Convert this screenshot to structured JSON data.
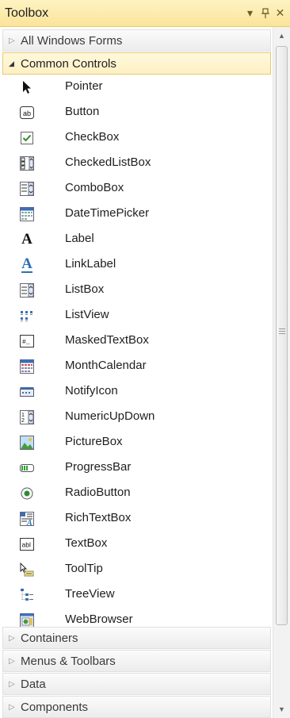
{
  "titlebar": {
    "title": "Toolbox",
    "dropdown_icon": "▾",
    "pin_icon": "⫠",
    "close_icon": "✕"
  },
  "groups": {
    "all_windows_forms": "All Windows Forms",
    "common_controls": "Common Controls",
    "containers": "Containers",
    "menus_toolbars": "Menus & Toolbars",
    "data": "Data",
    "components": "Components"
  },
  "tools": [
    {
      "label": "Pointer",
      "icon": "pointer-icon"
    },
    {
      "label": "Button",
      "icon": "button-icon"
    },
    {
      "label": "CheckBox",
      "icon": "checkbox-icon"
    },
    {
      "label": "CheckedListBox",
      "icon": "checkedlistbox-icon"
    },
    {
      "label": "ComboBox",
      "icon": "combobox-icon"
    },
    {
      "label": "DateTimePicker",
      "icon": "datetimepicker-icon"
    },
    {
      "label": "Label",
      "icon": "label-icon"
    },
    {
      "label": "LinkLabel",
      "icon": "linklabel-icon"
    },
    {
      "label": "ListBox",
      "icon": "listbox-icon"
    },
    {
      "label": "ListView",
      "icon": "listview-icon"
    },
    {
      "label": "MaskedTextBox",
      "icon": "maskedtextbox-icon"
    },
    {
      "label": "MonthCalendar",
      "icon": "monthcalendar-icon"
    },
    {
      "label": "NotifyIcon",
      "icon": "notifyicon-icon"
    },
    {
      "label": "NumericUpDown",
      "icon": "numericupdown-icon"
    },
    {
      "label": "PictureBox",
      "icon": "picturebox-icon"
    },
    {
      "label": "ProgressBar",
      "icon": "progressbar-icon"
    },
    {
      "label": "RadioButton",
      "icon": "radiobutton-icon"
    },
    {
      "label": "RichTextBox",
      "icon": "richtextbox-icon"
    },
    {
      "label": "TextBox",
      "icon": "textbox-icon"
    },
    {
      "label": "ToolTip",
      "icon": "tooltip-icon"
    },
    {
      "label": "TreeView",
      "icon": "treeview-icon"
    },
    {
      "label": "WebBrowser",
      "icon": "webbrowser-icon"
    }
  ],
  "colors": {
    "titlebar": "#fbe49a",
    "selected_group": "#fdf0c4",
    "accent_blue": "#2f6fb8",
    "check_green": "#2e8b2e"
  },
  "scrollbar": {
    "up_arrow": "▲",
    "down_arrow": "▼"
  }
}
